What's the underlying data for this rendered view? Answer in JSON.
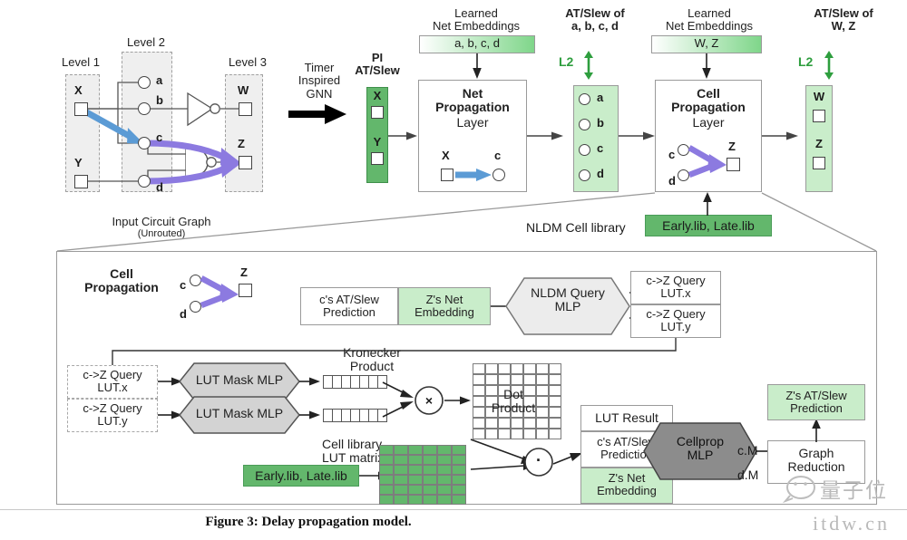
{
  "figure": {
    "caption": "Figure 3: Delay propagation model.",
    "watermark_cn": "量子位",
    "watermark_url": "itdw.cn"
  },
  "colors": {
    "green_light": "#c9edca",
    "green_dark": "#63b76c",
    "green_text": "#2e9e3e",
    "arrow_blue": "#5b9bd5",
    "arrow_purple": "#8c7ae0",
    "gray_mlp": "#d9d9d9",
    "gray_mlp_dark": "#8c8c8c",
    "border": "#9a9a9a"
  },
  "top": {
    "circuit": {
      "level1_label": "Level 1",
      "level2_label": "Level 2",
      "level3_label": "Level 3",
      "pins_level1": [
        "X",
        "Y"
      ],
      "pins_level2": [
        "a",
        "b",
        "c",
        "d"
      ],
      "pins_level3": [
        "W",
        "Z"
      ],
      "caption_line1": "Input Circuit Graph",
      "caption_line2": "(Unrouted)"
    },
    "gnn_label": "Timer\nInspired\nGNN",
    "pi": {
      "title": "PI\nAT/Slew",
      "items": [
        "X",
        "Y"
      ]
    },
    "net_embed_1": {
      "title": "Learned\nNet Embeddings",
      "value": "a, b, c, d"
    },
    "net_layer": {
      "title_bold": "Net\nPropagation",
      "title_rest": "Layer",
      "from": "X",
      "to": "c"
    },
    "at_slew_1": {
      "title": "AT/Slew of\na, b, c, d",
      "loss": "L2",
      "items": [
        "a",
        "b",
        "c",
        "d"
      ]
    },
    "net_embed_2": {
      "title": "Learned\nNet Embeddings",
      "value": "W, Z"
    },
    "cell_layer": {
      "title_bold": "Cell\nPropagation",
      "title_rest": "Layer",
      "from1": "c",
      "from2": "d",
      "to": "Z"
    },
    "at_slew_2": {
      "title": "AT/Slew of\nW, Z",
      "loss": "L2",
      "items": [
        "W",
        "Z"
      ]
    },
    "nldm_label": "NLDM Cell library",
    "nldm_libs": "Early.lib, Late.lib"
  },
  "bottom": {
    "title": "Cell\nPropagation",
    "mini_graph": {
      "from1": "c",
      "from2": "d",
      "to": "Z"
    },
    "input_stack": {
      "row1": "c's AT/Slew\nPrediction",
      "row2": "Z's Net\nEmbedding"
    },
    "nldm_query_mlp": "NLDM Query\nMLP",
    "query_out": {
      "x": "c->Z Query\nLUT.x",
      "y": "c->Z Query\nLUT.y"
    },
    "query_in": {
      "x": "c->Z Query\nLUT.x",
      "y": "c->Z Query\nLUT.y"
    },
    "lut_mask_mlp": "LUT Mask MLP",
    "kronecker_label": "Kronecker\nProduct",
    "kronecker_op": "×",
    "dot_label": "Dot\nProduct",
    "dot_op": "·",
    "cell_lib_label": "Cell library\nLUT matrix",
    "cell_lib_libs": "Early.lib, Late.lib",
    "result_stack": {
      "row1": "LUT Result",
      "row2": "c's AT/Slew\nPrediction",
      "row3": "Z's Net\nEmbedding"
    },
    "cellprop_mlp": "Cellprop\nMLP",
    "out_c": "c.M",
    "out_d": "d.M",
    "graph_reduction": "Graph\nReduction",
    "z_pred": "Z's AT/Slew\nPrediction"
  }
}
